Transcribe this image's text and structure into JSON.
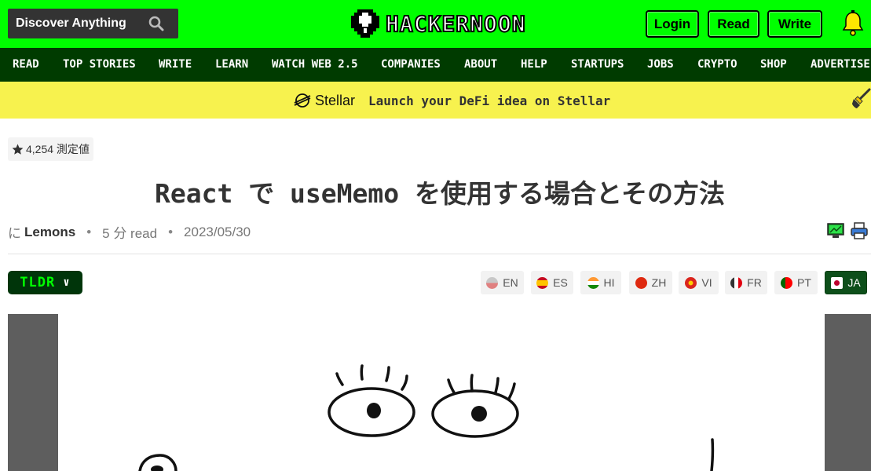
{
  "header": {
    "search_label": "Discover Anything",
    "logo_text": "HACKERNOON",
    "login_label": "Login",
    "read_label": "Read",
    "write_label": "Write",
    "accent_color": "#00ff00"
  },
  "nav": {
    "items": [
      "READ",
      "TOP STORIES",
      "WRITE",
      "LEARN",
      "WATCH WEB 2.5",
      "COMPANIES",
      "ABOUT",
      "HELP",
      "STARTUPS",
      "JOBS",
      "CRYPTO",
      "SHOP",
      "ADVERTISE"
    ]
  },
  "banner": {
    "sponsor": "Stellar",
    "text": "Launch your DeFi idea on Stellar"
  },
  "article": {
    "rating": "4,254 測定値",
    "title": "React で useMemo を使用する場合とその方法",
    "by_prefix": "に",
    "author": "Lemons",
    "read_time": "5 分 read",
    "date": "2023/05/30"
  },
  "tldr_label": "TLDR",
  "languages": [
    {
      "code": "EN",
      "active": false
    },
    {
      "code": "ES",
      "active": false
    },
    {
      "code": "HI",
      "active": false
    },
    {
      "code": "ZH",
      "active": false
    },
    {
      "code": "VI",
      "active": false
    },
    {
      "code": "FR",
      "active": false
    },
    {
      "code": "PT",
      "active": false
    },
    {
      "code": "JA",
      "active": true
    }
  ]
}
